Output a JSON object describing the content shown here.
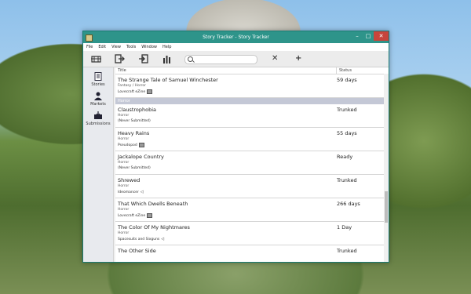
{
  "window": {
    "title": "Story Tracker - Story Tracker",
    "min_glyph": "–",
    "max_glyph": "□",
    "close_glyph": "✕"
  },
  "menu": [
    "File",
    "Edit",
    "View",
    "Tools",
    "Window",
    "Help"
  ],
  "toolbar": {
    "search_placeholder": "",
    "clear_glyph": "✕",
    "add_glyph": "+"
  },
  "sidebar": {
    "items": [
      {
        "label": "Stories",
        "icon": "stories-icon"
      },
      {
        "label": "Markets",
        "icon": "markets-icon"
      },
      {
        "label": "Submissions",
        "icon": "submissions-icon"
      }
    ]
  },
  "table": {
    "headers": {
      "title": "Title",
      "status": "Status"
    },
    "top_row": {
      "title": "The Strange Tale of Samuel Winchester",
      "genre": "Fantasy / Horror",
      "market": "Lovecraft eZine",
      "status": "59 days"
    },
    "group_label": "Horror",
    "rows": [
      {
        "title": "Claustrophobia",
        "genre": "Horror",
        "market": "(Never Submitted)",
        "status": "Trunked"
      },
      {
        "title": "Heavy Rains",
        "genre": "Horror",
        "market": "Pseudopod",
        "status": "55 days"
      },
      {
        "title": "Jackalope Country",
        "genre": "Horror",
        "market": "(Never Submitted)",
        "status": "Ready"
      },
      {
        "title": "Shrewed",
        "genre": "Horror",
        "market": "Ideomancer",
        "status": "Trunked"
      },
      {
        "title": "That Which Dwells Beneath",
        "genre": "Horror",
        "market": "Lovecraft eZine",
        "status": "266 days"
      },
      {
        "title": "The Color Of My Nightmares",
        "genre": "Horror",
        "market": "Spacesuits and Sixguns",
        "status": "1 Day"
      },
      {
        "title": "The Other Side",
        "genre": "",
        "market": "",
        "status": "Trunked"
      }
    ]
  },
  "colors": {
    "titlebar": "#2e948a",
    "close": "#c7443b",
    "group": "#c4c8d6"
  }
}
